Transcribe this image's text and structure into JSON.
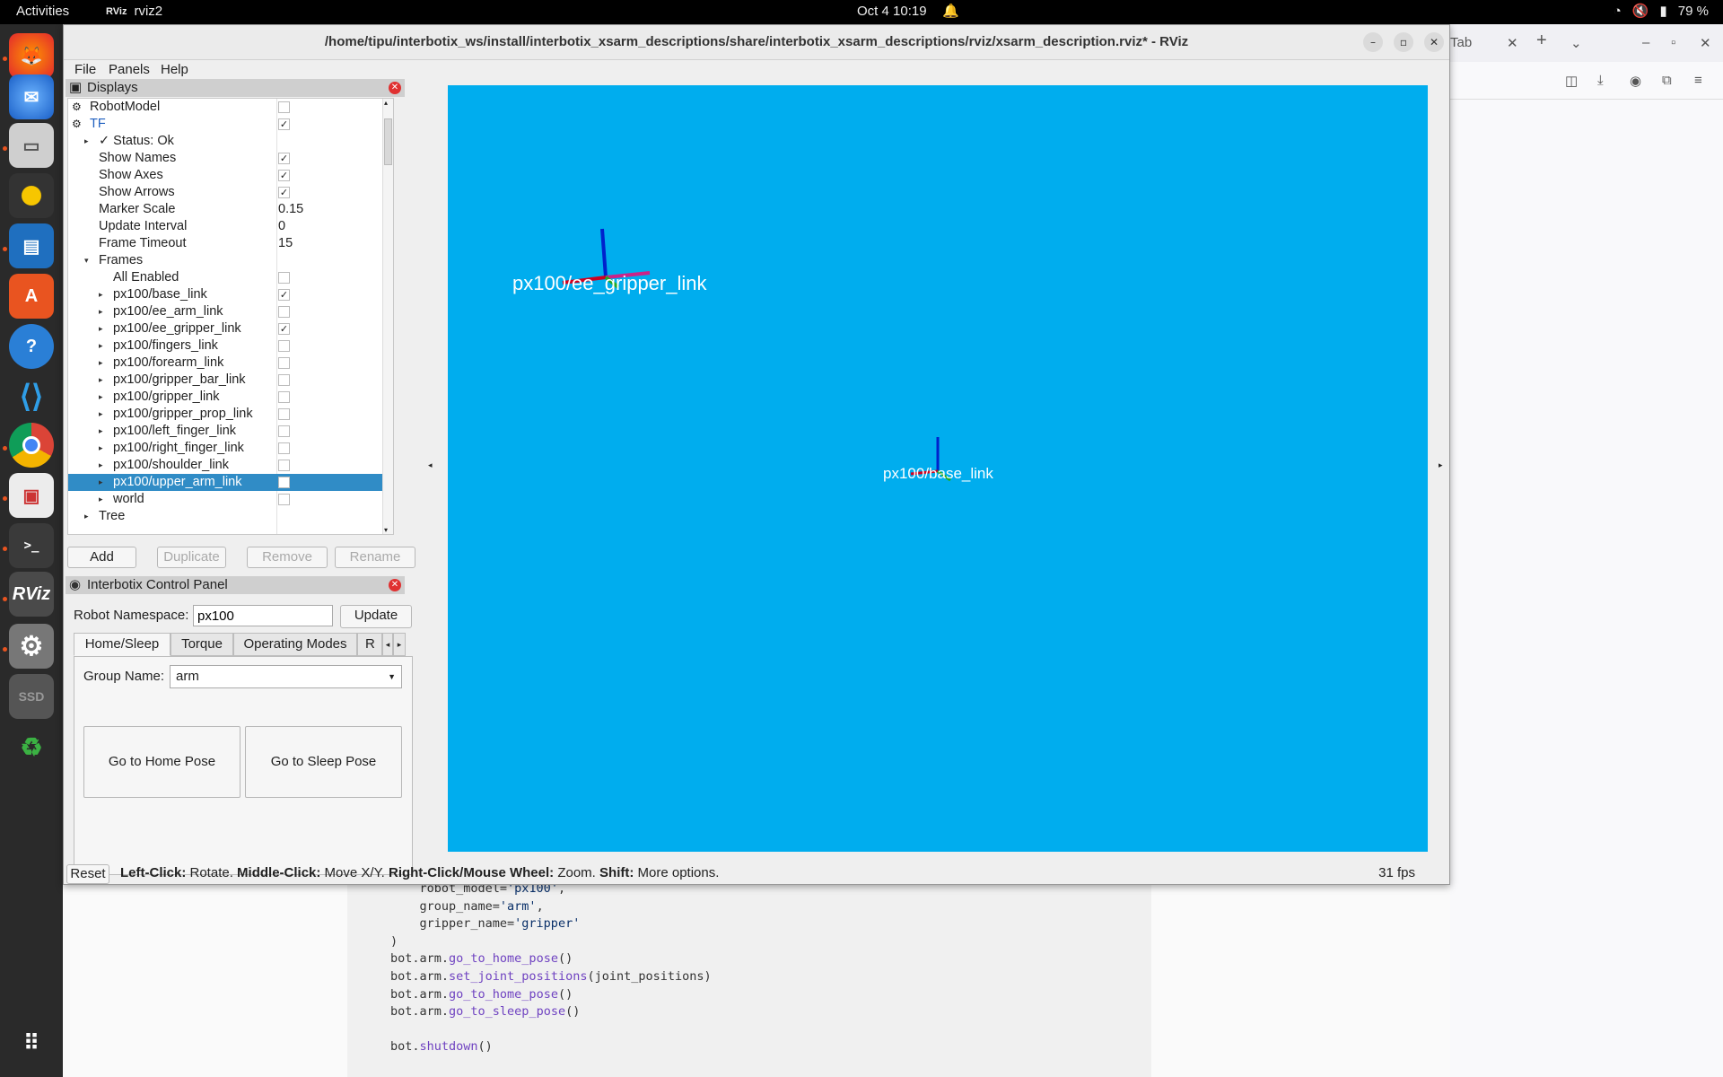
{
  "topbar": {
    "activities": "Activities",
    "app_name": "rviz2",
    "clock": "Oct 4  10:19",
    "battery": "79 %"
  },
  "browser": {
    "tab_label": "Tab",
    "code_lines": [
      {
        "pre": "    robot_model=",
        "str": "'px100'",
        "post": ","
      },
      {
        "pre": "    group_name=",
        "str": "'arm'",
        "post": ","
      },
      {
        "pre": "    gripper_name=",
        "str": "'gripper'",
        "post": ""
      },
      {
        "pre": ")",
        "str": "",
        "post": ""
      },
      {
        "pre": "bot.arm.",
        "fn": "go_to_home_pose",
        "post": "()"
      },
      {
        "pre": "bot.arm.",
        "fn": "set_joint_positions",
        "post": "(joint_positions)"
      },
      {
        "pre": "bot.arm.",
        "fn": "go_to_home_pose",
        "post": "()"
      },
      {
        "pre": "bot.arm.",
        "fn": "go_to_sleep_pose",
        "post": "()"
      },
      {
        "pre": "",
        "post": ""
      },
      {
        "pre": "bot.",
        "fn": "shutdown",
        "post": "()"
      }
    ]
  },
  "window": {
    "title": "/home/tipu/interbotix_ws/install/interbotix_xsarm_descriptions/share/interbotix_xsarm_descriptions/rviz/xsarm_description.rviz* - RViz"
  },
  "menu": {
    "file": "File",
    "panels": "Panels",
    "help": "Help"
  },
  "displays": {
    "title": "Displays",
    "rows": [
      {
        "label": "RobotModel",
        "indent": 0,
        "arrow": "",
        "cb": "off"
      },
      {
        "label": "TF",
        "indent": 0,
        "arrow": "",
        "cb": "on",
        "blue": true
      },
      {
        "label": "✓ Status: Ok",
        "indent": 1,
        "arrow": "▸",
        "cb": ""
      },
      {
        "label": "Show Names",
        "indent": 1,
        "arrow": "",
        "cb": "on"
      },
      {
        "label": "Show Axes",
        "indent": 1,
        "arrow": "",
        "cb": "on"
      },
      {
        "label": "Show Arrows",
        "indent": 1,
        "arrow": "",
        "cb": "on"
      },
      {
        "label": "Marker Scale",
        "indent": 1,
        "arrow": "",
        "value": "0.15"
      },
      {
        "label": "Update Interval",
        "indent": 1,
        "arrow": "",
        "value": "0"
      },
      {
        "label": "Frame Timeout",
        "indent": 1,
        "arrow": "",
        "value": "15"
      },
      {
        "label": "Frames",
        "indent": 1,
        "arrow": "▾",
        "cb": ""
      },
      {
        "label": "All Enabled",
        "indent": 2,
        "arrow": "",
        "cb": "off"
      },
      {
        "label": "px100/base_link",
        "indent": 2,
        "arrow": "▸",
        "cb": "on"
      },
      {
        "label": "px100/ee_arm_link",
        "indent": 2,
        "arrow": "▸",
        "cb": "off"
      },
      {
        "label": "px100/ee_gripper_link",
        "indent": 2,
        "arrow": "▸",
        "cb": "on"
      },
      {
        "label": "px100/fingers_link",
        "indent": 2,
        "arrow": "▸",
        "cb": "off"
      },
      {
        "label": "px100/forearm_link",
        "indent": 2,
        "arrow": "▸",
        "cb": "off"
      },
      {
        "label": "px100/gripper_bar_link",
        "indent": 2,
        "arrow": "▸",
        "cb": "off"
      },
      {
        "label": "px100/gripper_link",
        "indent": 2,
        "arrow": "▸",
        "cb": "off"
      },
      {
        "label": "px100/gripper_prop_link",
        "indent": 2,
        "arrow": "▸",
        "cb": "off"
      },
      {
        "label": "px100/left_finger_link",
        "indent": 2,
        "arrow": "▸",
        "cb": "off"
      },
      {
        "label": "px100/right_finger_link",
        "indent": 2,
        "arrow": "▸",
        "cb": "off"
      },
      {
        "label": "px100/shoulder_link",
        "indent": 2,
        "arrow": "▸",
        "cb": "off"
      },
      {
        "label": "px100/upper_arm_link",
        "indent": 2,
        "arrow": "▸",
        "cb": "off",
        "selected": true
      },
      {
        "label": "world",
        "indent": 2,
        "arrow": "▸",
        "cb": "off"
      },
      {
        "label": "Tree",
        "indent": 1,
        "arrow": "▸",
        "cb": ""
      }
    ],
    "buttons": {
      "add": "Add",
      "duplicate": "Duplicate",
      "remove": "Remove",
      "rename": "Rename"
    }
  },
  "control": {
    "title": "Interbotix Control Panel",
    "ns_label": "Robot Namespace:",
    "ns_value": "px100",
    "update": "Update",
    "tabs": [
      "Home/Sleep",
      "Torque",
      "Operating Modes",
      "R"
    ],
    "group_label": "Group Name:",
    "group_value": "arm",
    "home": "Go to Home Pose",
    "sleep": "Go to Sleep Pose"
  },
  "viewport": {
    "frame1": "px100/ee_gripper_link",
    "frame2": "px100/base_link"
  },
  "status": {
    "reset": "Reset",
    "k1": "Left-Click:",
    "v1": " Rotate. ",
    "k2": "Middle-Click:",
    "v2": " Move X/Y. ",
    "k3": "Right-Click/Mouse Wheel:",
    "v3": " Zoom. ",
    "k4": "Shift:",
    "v4": " More options.",
    "fps": "31 fps"
  },
  "colors": {
    "viewport": "#00adee",
    "selection": "#308cc6",
    "dock": "#2a2a2a"
  }
}
